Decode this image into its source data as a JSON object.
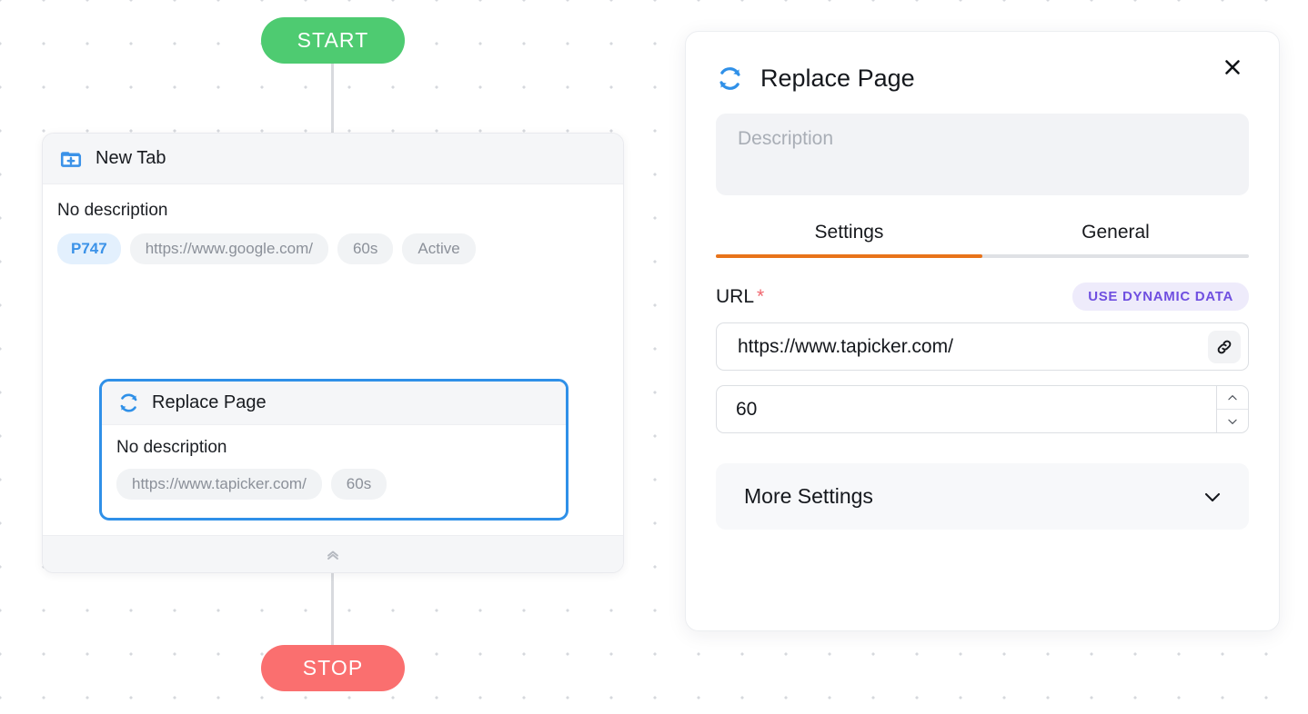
{
  "flow": {
    "start_label": "START",
    "stop_label": "STOP",
    "group_node": {
      "icon": "new-tab-icon",
      "title": "New Tab",
      "description": "No description",
      "chips": [
        "P747",
        "https://www.google.com/",
        "60s",
        "Active"
      ],
      "collapse_icon": "chevrons-up-icon"
    },
    "child_node": {
      "icon": "replace-page-icon",
      "title": "Replace Page",
      "description": "No description",
      "chips": [
        "https://www.tapicker.com/",
        "60s"
      ]
    }
  },
  "panel": {
    "icon": "replace-page-icon",
    "title": "Replace Page",
    "close_icon": "close-icon",
    "description_value": "",
    "description_placeholder": "Description",
    "tabs": [
      {
        "label": "Settings",
        "active": true
      },
      {
        "label": "General",
        "active": false
      }
    ],
    "url_field": {
      "label": "URL",
      "required_marker": "*",
      "dynamic_data_label": "USE DYNAMIC DATA",
      "value": "https://www.tapicker.com/",
      "placeholder": "",
      "action_icon": "link-icon"
    },
    "timeout_field": {
      "value": "60",
      "placeholder": "",
      "increment_icon": "chevron-up-icon",
      "decrement_icon": "chevron-down-icon"
    },
    "more_settings": {
      "label": "More Settings",
      "expand_icon": "chevron-down-icon"
    }
  },
  "colors": {
    "start": "#4ecb71",
    "stop": "#fa6f6f",
    "selected_border": "#2f90e8",
    "tab_active": "#e8731a",
    "dynamic_badge_text": "#6f4fe0",
    "dynamic_badge_bg": "#eeebfb",
    "node_icon": "#3b92e8",
    "chip_id_text": "#3b92e8",
    "chip_id_bg": "#e3f0fd"
  }
}
